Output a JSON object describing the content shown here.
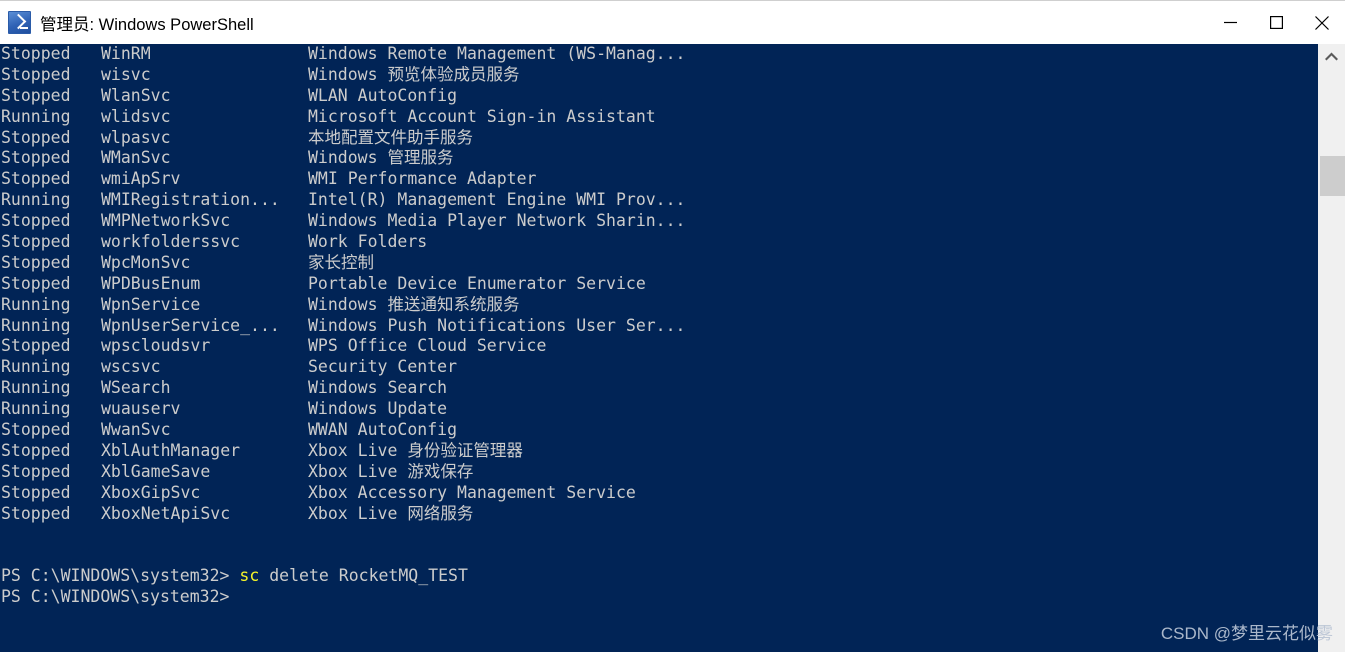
{
  "window": {
    "title": "管理员: Windows PowerShell",
    "app_icon": "powershell-icon",
    "controls": {
      "minimize": "minimize-icon",
      "maximize": "maximize-icon",
      "close": "close-icon"
    }
  },
  "terminal": {
    "background_color": "#012456",
    "text_color": "#cccccc",
    "highlight_color": "#f3f32a",
    "services": [
      {
        "status": "Stopped",
        "name": "WinRM",
        "description": "Windows Remote Management (WS-Manag..."
      },
      {
        "status": "Stopped",
        "name": "wisvc",
        "description": "Windows 预览体验成员服务"
      },
      {
        "status": "Stopped",
        "name": "WlanSvc",
        "description": "WLAN AutoConfig"
      },
      {
        "status": "Running",
        "name": "wlidsvc",
        "description": "Microsoft Account Sign-in Assistant"
      },
      {
        "status": "Stopped",
        "name": "wlpasvc",
        "description": "本地配置文件助手服务"
      },
      {
        "status": "Stopped",
        "name": "WManSvc",
        "description": "Windows 管理服务"
      },
      {
        "status": "Stopped",
        "name": "wmiApSrv",
        "description": "WMI Performance Adapter"
      },
      {
        "status": "Running",
        "name": "WMIRegistration...",
        "description": "Intel(R) Management Engine WMI Prov..."
      },
      {
        "status": "Stopped",
        "name": "WMPNetworkSvc",
        "description": "Windows Media Player Network Sharin..."
      },
      {
        "status": "Stopped",
        "name": "workfolderssvc",
        "description": "Work Folders"
      },
      {
        "status": "Stopped",
        "name": "WpcMonSvc",
        "description": "家长控制"
      },
      {
        "status": "Stopped",
        "name": "WPDBusEnum",
        "description": "Portable Device Enumerator Service"
      },
      {
        "status": "Running",
        "name": "WpnService",
        "description": "Windows 推送通知系统服务"
      },
      {
        "status": "Running",
        "name": "WpnUserService_...",
        "description": "Windows Push Notifications User Ser..."
      },
      {
        "status": "Stopped",
        "name": "wpscloudsvr",
        "description": "WPS Office Cloud Service"
      },
      {
        "status": "Running",
        "name": "wscsvc",
        "description": "Security Center"
      },
      {
        "status": "Running",
        "name": "WSearch",
        "description": "Windows Search"
      },
      {
        "status": "Running",
        "name": "wuauserv",
        "description": "Windows Update"
      },
      {
        "status": "Stopped",
        "name": "WwanSvc",
        "description": "WWAN AutoConfig"
      },
      {
        "status": "Stopped",
        "name": "XblAuthManager",
        "description": "Xbox Live 身份验证管理器"
      },
      {
        "status": "Stopped",
        "name": "XblGameSave",
        "description": "Xbox Live 游戏保存"
      },
      {
        "status": "Stopped",
        "name": "XboxGipSvc",
        "description": "Xbox Accessory Management Service"
      },
      {
        "status": "Stopped",
        "name": "XboxNetApiSvc",
        "description": "Xbox Live 网络服务"
      }
    ],
    "prompts": [
      {
        "prompt": "PS C:\\WINDOWS\\system32> ",
        "command_keyword": "sc",
        "command_rest": " delete RocketMQ_TEST"
      },
      {
        "prompt": "PS C:\\WINDOWS\\system32>",
        "command_keyword": "",
        "command_rest": ""
      }
    ]
  },
  "scrollbar": {
    "up_arrow": "chevron-up-icon"
  },
  "watermark": "CSDN @梦里云花似雾"
}
